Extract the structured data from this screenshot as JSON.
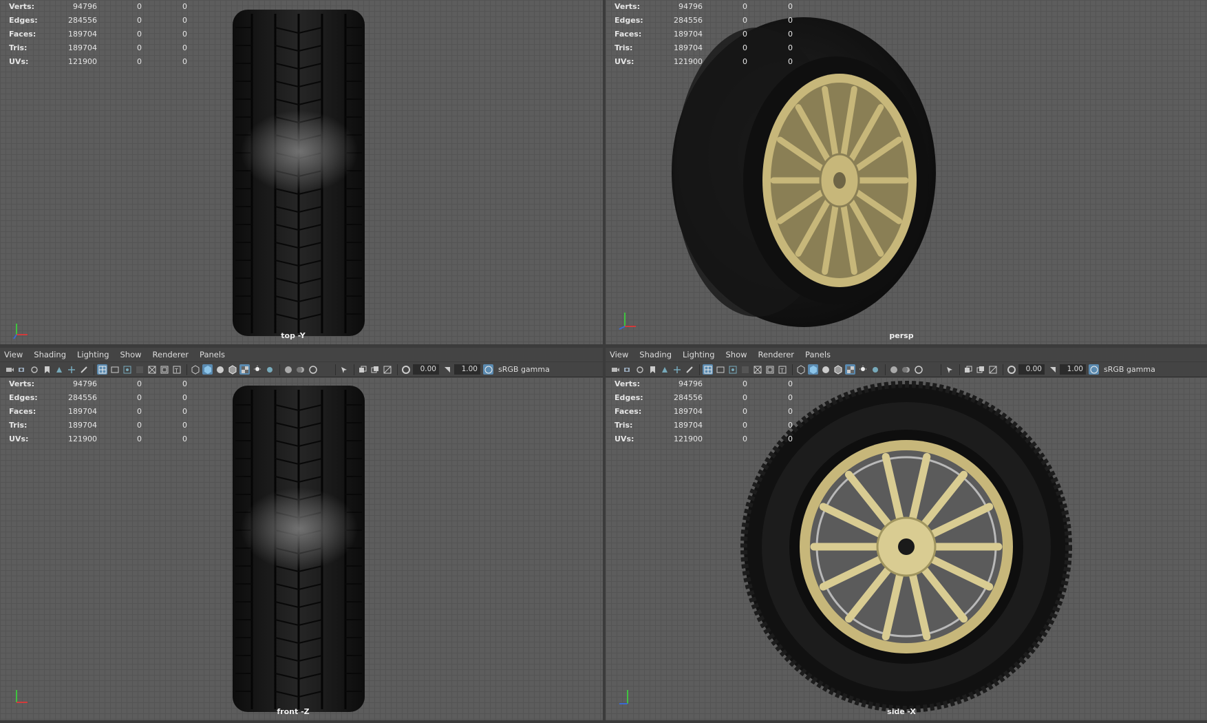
{
  "stats": [
    {
      "label": "Verts:",
      "v1": "94796",
      "v2": "0",
      "v3": "0"
    },
    {
      "label": "Edges:",
      "v1": "284556",
      "v2": "0",
      "v3": "0"
    },
    {
      "label": "Faces:",
      "v1": "189704",
      "v2": "0",
      "v3": "0"
    },
    {
      "label": "Tris:",
      "v1": "189704",
      "v2": "0",
      "v3": "0"
    },
    {
      "label": "UVs:",
      "v1": "121900",
      "v2": "0",
      "v3": "0"
    }
  ],
  "viewports": {
    "top": {
      "camera": "top -Y"
    },
    "persp": {
      "camera": "persp"
    },
    "front": {
      "camera": "front -Z"
    },
    "side": {
      "camera": "side -X"
    }
  },
  "menu": [
    "View",
    "Shading",
    "Lighting",
    "Show",
    "Renderer",
    "Panels"
  ],
  "toolbar": {
    "exposure": "0.00",
    "gamma": "1.00",
    "color_space": "sRGB gamma"
  },
  "colors": {
    "rim": "#c7b77a",
    "tire": "#141414",
    "grid": "#5d5d5d",
    "active": "#5a8ab0"
  }
}
